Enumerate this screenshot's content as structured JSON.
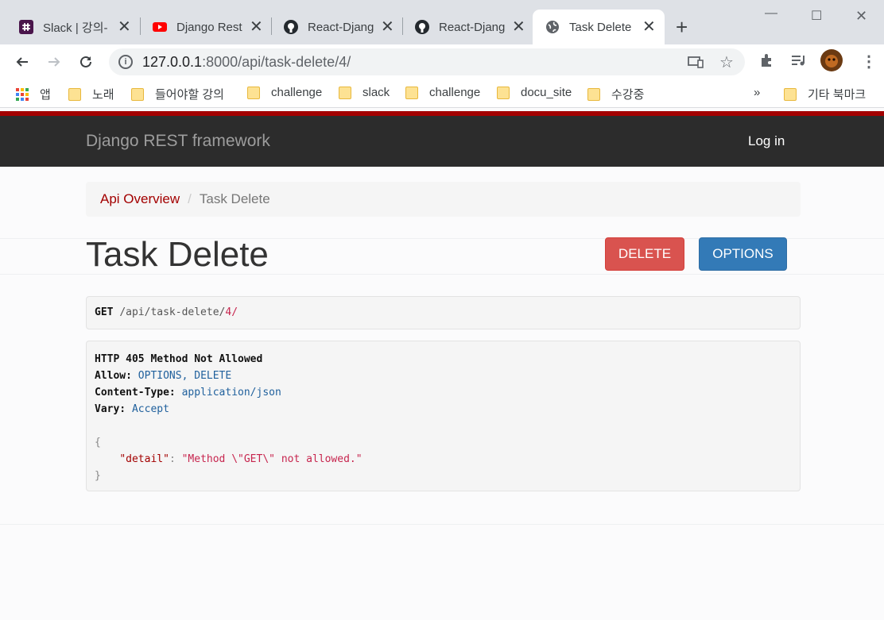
{
  "browser": {
    "tabs": [
      {
        "title": "Slack | 강의-",
        "icon": "slack-icon"
      },
      {
        "title": "Django Rest",
        "icon": "youtube-icon"
      },
      {
        "title": "React-Djang",
        "icon": "github-icon"
      },
      {
        "title": "React-Djang",
        "icon": "github-icon"
      },
      {
        "title": "Task Delete",
        "icon": "globe-icon",
        "active": true
      }
    ],
    "url_host": "127.0.0.1",
    "url_rest": ":8000/api/task-delete/4/",
    "bookmarks": [
      {
        "label": "앱",
        "type": "apps"
      },
      {
        "label": "노래",
        "type": "folder"
      },
      {
        "label": "들어야할 강의",
        "type": "folder"
      },
      {
        "label": "challenge",
        "type": "folder"
      },
      {
        "label": "slack",
        "type": "folder"
      },
      {
        "label": "challenge",
        "type": "folder"
      },
      {
        "label": "docu_site",
        "type": "folder"
      },
      {
        "label": "수강중",
        "type": "folder"
      }
    ],
    "bookmarks_overflow": "»",
    "other_bookmarks": "기타 북마크"
  },
  "navbar": {
    "brand": "Django REST framework",
    "login": "Log in"
  },
  "breadcrumb": {
    "link": "Api Overview",
    "divider": "/",
    "active": "Task Delete"
  },
  "page": {
    "title": "Task Delete",
    "delete_label": "DELETE",
    "options_label": "OPTIONS"
  },
  "request": {
    "method": "GET",
    "path": "/api/task-delete/",
    "pk": "4/"
  },
  "response": {
    "status": "HTTP 405 Method Not Allowed",
    "allow_key": "Allow:",
    "allow_val": "OPTIONS, DELETE",
    "ctype_key": "Content-Type:",
    "ctype_val": "application/json",
    "vary_key": "Vary:",
    "vary_val": "Accept",
    "open_brace": "{",
    "json_key": "\"detail\"",
    "json_colon": ":",
    "json_val": "\"Method \\\"GET\\\" not allowed.\"",
    "close_brace": "}"
  },
  "colors": {
    "navbar_bg": "#2c2c2c",
    "accent_red": "#a30000",
    "delete_btn": "#d9534f",
    "options_btn": "#337ab7"
  }
}
